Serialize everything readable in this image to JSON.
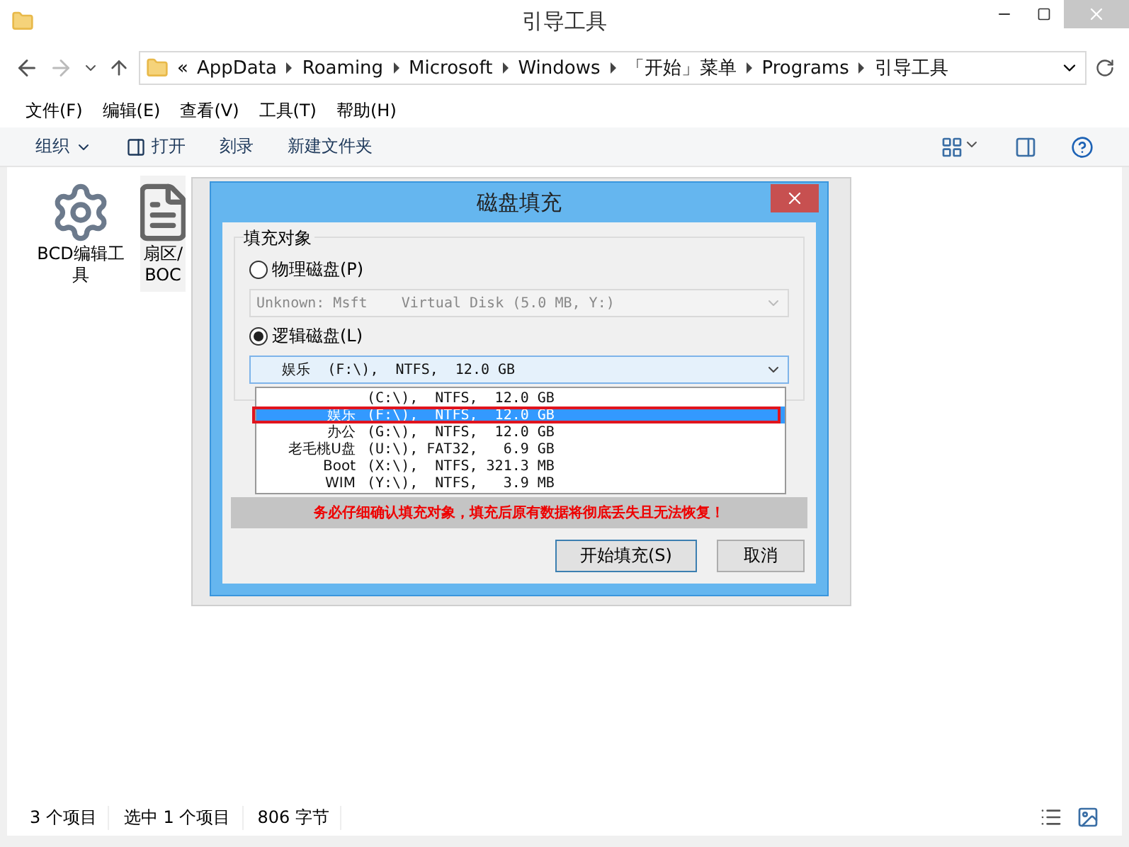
{
  "window": {
    "title": "引导工具"
  },
  "address": {
    "overflow": "«",
    "crumbs": [
      "AppData",
      "Roaming",
      "Microsoft",
      "Windows",
      "「开始」菜单",
      "Programs",
      "引导工具"
    ]
  },
  "menu": [
    "文件(F)",
    "编辑(E)",
    "查看(V)",
    "工具(T)",
    "帮助(H)"
  ],
  "toolbar": [
    {
      "kind": "dropdown",
      "label": "组织"
    },
    {
      "kind": "icon",
      "label": "打开"
    },
    {
      "kind": "plain",
      "label": "刻录"
    },
    {
      "kind": "plain",
      "label": "新建文件夹"
    }
  ],
  "files": [
    {
      "kind": "gear",
      "lines": [
        "BCD编辑工",
        "具"
      ],
      "selected": false
    },
    {
      "kind": "document",
      "lines": [
        "扇区/",
        "BOC"
      ],
      "selected": true
    }
  ],
  "dialog": {
    "title": "磁盘填充",
    "group": "填充对象",
    "options": [
      {
        "label": "物理磁盘(P)",
        "selected": false,
        "combo": {
          "value": "Unknown: Msft    Virtual Disk (5.0 MB, Y:)",
          "disabled": true
        }
      },
      {
        "label": "逻辑磁盘(L)",
        "selected": true,
        "combo": {
          "value": "   娱乐  (F:\\),  NTFS,  12.0 GB",
          "disabled": false,
          "open": true
        }
      }
    ],
    "list": [
      {
        "details": "(C:\\),  NTFS,  12.0 GB",
        "selected": false
      },
      {
        "label": "娱乐",
        "details": "(F:\\),  NTFS,  12.0 GB",
        "selected": true
      },
      {
        "label": "办公",
        "details": "(G:\\),  NTFS,  12.0 GB",
        "selected": false
      },
      {
        "label": "老毛桃U盘",
        "details": "(U:\\), FAT32,   6.9 GB",
        "selected": false
      },
      {
        "label": "Boot",
        "details": "(X:\\),  NTFS, 321.3 MB",
        "selected": false
      },
      {
        "label": "WIM",
        "details": "(Y:\\),  NTFS,   3.9 MB",
        "selected": false
      }
    ],
    "warning": "务必仔细确认填充对象，填充后原有数据将彻底丢失且无法恢复！",
    "buttons": [
      "开始填充(S)",
      "取消"
    ]
  },
  "status_bar": {
    "items": [
      "3 个项目",
      "选中 1 个项目",
      "806 字节"
    ]
  }
}
